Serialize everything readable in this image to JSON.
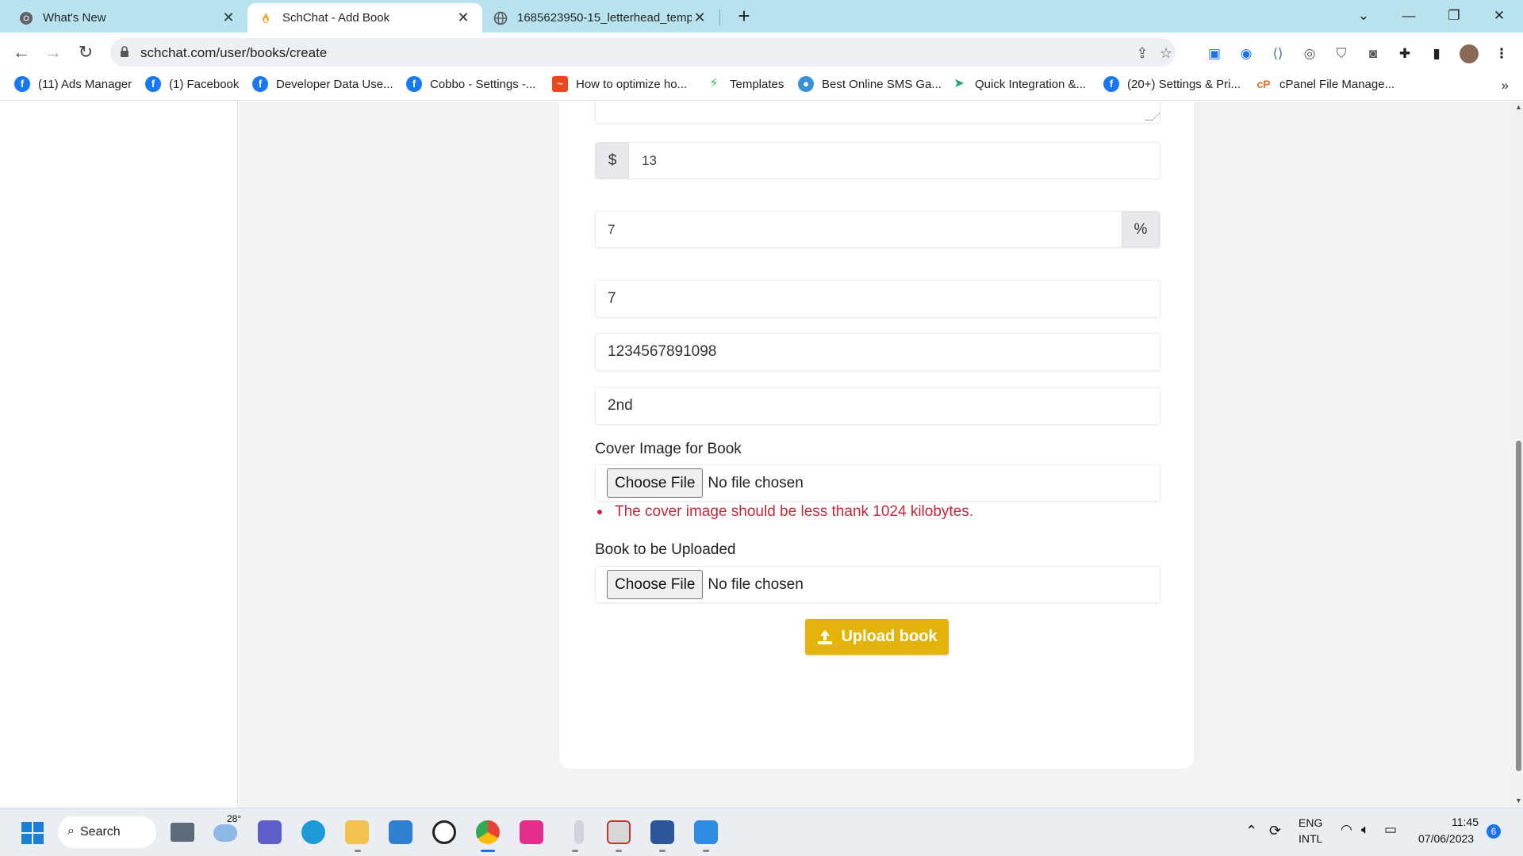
{
  "browser": {
    "tabs": [
      {
        "title": "What's New",
        "active": false
      },
      {
        "title": "SchChat - Add Book",
        "active": true
      },
      {
        "title": "1685623950-15_letterhead_temp",
        "active": false
      }
    ],
    "url": "schchat.com/user/books/create"
  },
  "bookmarks": [
    {
      "label": "(11) Ads Manager",
      "icon": "facebook-icon"
    },
    {
      "label": "(1) Facebook",
      "icon": "facebook-icon"
    },
    {
      "label": "Developer Data Use...",
      "icon": "facebook-icon"
    },
    {
      "label": "Cobbo - Settings -...",
      "icon": "facebook-icon"
    },
    {
      "label": "How to optimize ho...",
      "icon": "chart-icon"
    },
    {
      "label": "Templates",
      "icon": "bolt-icon"
    },
    {
      "label": "Best Online SMS Ga...",
      "icon": "globe-icon"
    },
    {
      "label": "Quick Integration &...",
      "icon": "arrow-icon"
    },
    {
      "label": "(20+) Settings & Pri...",
      "icon": "facebook-icon"
    },
    {
      "label": "cPanel File Manage...",
      "icon": "cpanel-icon"
    }
  ],
  "form": {
    "price_addon": "$",
    "price_value": "13",
    "discount_value": "7",
    "discount_addon": "%",
    "quantity_value": "7",
    "isbn_value": "1234567891098",
    "edition_value": "2nd",
    "cover_label": "Cover Image for Book",
    "cover_button": "Choose File",
    "cover_status": "No file chosen",
    "cover_error": "The cover image should be less thank 1024 kilobytes.",
    "book_label": "Book to be Uploaded",
    "book_button": "Choose File",
    "book_status": "No file chosen",
    "submit_label": "Upload book"
  },
  "colors": {
    "tabbar": "#b8e3ee",
    "error": "#c4283c",
    "upload_button": "#e4b30a"
  },
  "taskbar": {
    "search_label": "Search",
    "weather_temp": "28°",
    "lang_1": "ENG",
    "lang_2": "INTL",
    "time": "11:45",
    "date": "07/06/2023",
    "notification_count": "6"
  }
}
